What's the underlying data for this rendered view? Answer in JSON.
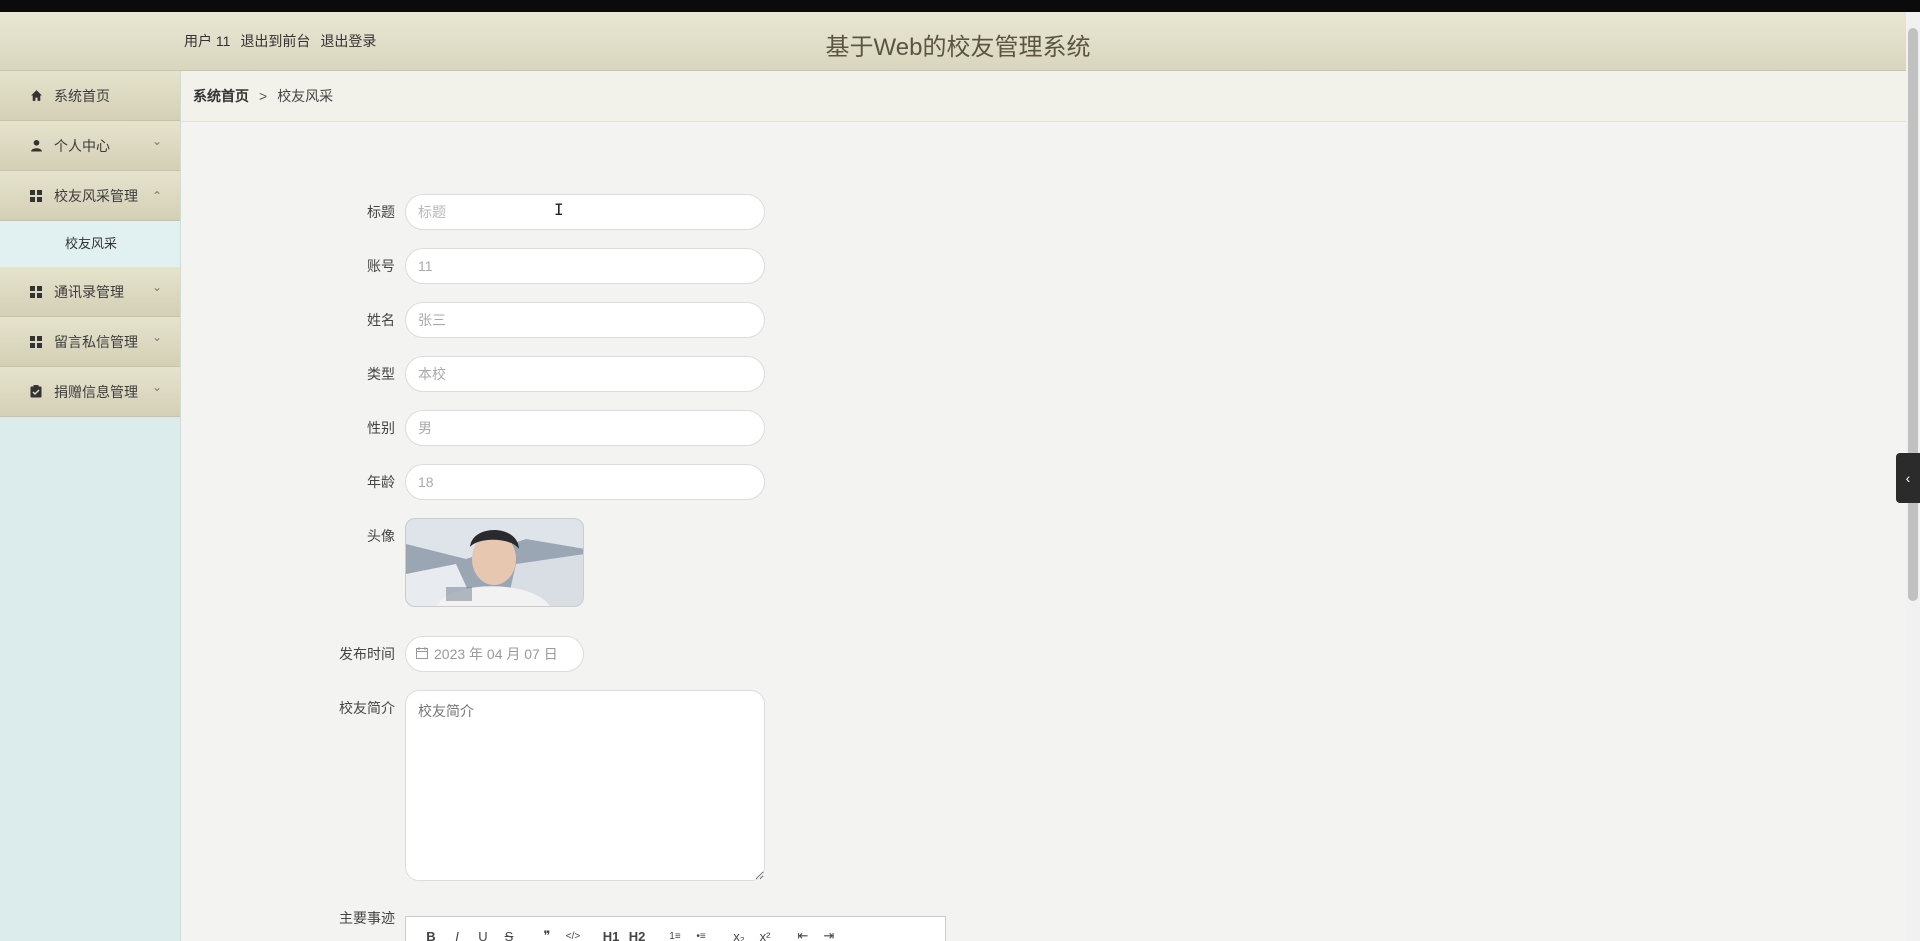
{
  "header": {
    "user_label": "用户 11",
    "back_to_front": "退出到前台",
    "logout": "退出登录",
    "title": "基于Web的校友管理系统"
  },
  "sidebar": {
    "items": [
      {
        "label": "系统首页",
        "icon": "home-icon"
      },
      {
        "label": "个人中心",
        "icon": "user-icon"
      },
      {
        "label": "校友风采管理",
        "icon": "grid-icon",
        "expanded": true,
        "children": [
          {
            "label": "校友风采"
          }
        ]
      },
      {
        "label": "通讯录管理",
        "icon": "grid-icon"
      },
      {
        "label": "留言私信管理",
        "icon": "grid-icon"
      },
      {
        "label": "捐赠信息管理",
        "icon": "clipboard-icon"
      }
    ]
  },
  "breadcrumb": {
    "home": "系统首页",
    "separator": ">",
    "current": "校友风采"
  },
  "form": {
    "title": {
      "label": "标题",
      "placeholder": "标题",
      "value": ""
    },
    "account": {
      "label": "账号",
      "value": "11"
    },
    "name": {
      "label": "姓名",
      "value": "张三"
    },
    "type": {
      "label": "类型",
      "value": "本校"
    },
    "gender": {
      "label": "性别",
      "value": "男"
    },
    "age": {
      "label": "年龄",
      "value": "18"
    },
    "avatar": {
      "label": "头像"
    },
    "publish_time": {
      "label": "发布时间",
      "value": "2023 年 04 月 07 日"
    },
    "intro": {
      "label": "校友简介",
      "placeholder": "校友简介"
    },
    "deeds": {
      "label": "主要事迹"
    }
  },
  "editor_toolbar": [
    "B",
    "I",
    "U",
    "S",
    "❞",
    "</>",
    "H1",
    "H2",
    "1≡",
    "•≡",
    "x₂",
    "x²",
    "⇤",
    "⇥"
  ]
}
